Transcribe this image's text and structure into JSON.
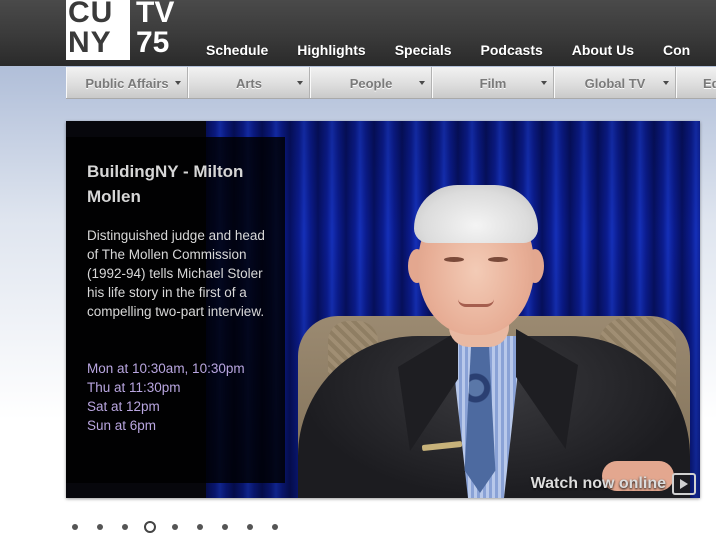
{
  "logo": {
    "cuny_line1": "CU",
    "cuny_line2": "NY",
    "tv_line1": "TV",
    "tv_line2": "75"
  },
  "main_nav": [
    "Schedule",
    "Highlights",
    "Specials",
    "Podcasts",
    "About Us",
    "Con"
  ],
  "sub_nav": [
    "Public Affairs",
    "Arts",
    "People",
    "Film",
    "Global TV",
    "Ed"
  ],
  "feature": {
    "title": "BuildingNY - Milton Mollen",
    "description": "Distinguished judge and head of The Mollen Commission (1992-94) tells Michael Stoler his life story in the first of a compelling two-part interview.",
    "schedule": [
      "Mon at 10:30am, 10:30pm",
      "Thu at 11:30pm",
      "Sat at 12pm",
      "Sun at 6pm"
    ],
    "watch_label": "Watch now online"
  },
  "pager": {
    "count": 9,
    "active_index": 3
  },
  "colors": {
    "header": "#3a3a3a",
    "schedule_text": "#b9a6e0",
    "curtain": "#0b1c8f"
  },
  "icons": [
    "play-icon",
    "dropdown-arrow-icon"
  ]
}
